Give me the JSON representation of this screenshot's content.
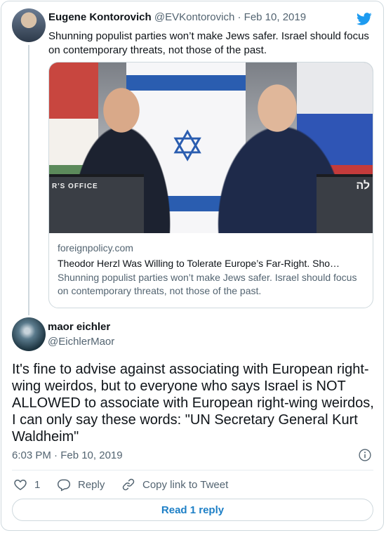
{
  "parent": {
    "name": "Eugene Kontorovich",
    "handle": "@EVKontorovich",
    "separator": "·",
    "date": "Feb 10, 2019",
    "text": "Shunning populist parties won’t make Jews safer. Israel should focus on contemporary threats, not those of the past.",
    "link_card": {
      "domain": "foreignpolicy.com",
      "headline": "Theodor Herzl Was Willing to Tolerate Europe’s Far-Right. Sho…",
      "description": "Shunning populist parties won’t make Jews safer. Israel should focus on contemporary threats, not those of the past.",
      "podium_left_text": "R'S OFFICE",
      "podium_right_text": "לה"
    }
  },
  "tweet": {
    "name": "maor eichler",
    "handle": "@EichlerMaor",
    "text": "It's fine to advise against associating with European right-wing weirdos, but to everyone who says Israel is NOT ALLOWED to associate with European right-wing weirdos, I can only say these words: \"UN Secretary General Kurt Waldheim\"",
    "time": "6:03 PM · Feb 10, 2019"
  },
  "actions": {
    "like_count": "1",
    "reply_label": "Reply",
    "copy_label": "Copy link to Tweet"
  },
  "read_button": "Read 1 reply",
  "icons": {
    "brand": "twitter-bird-icon",
    "info": "info-icon",
    "like": "heart-icon",
    "reply": "reply-bubble-icon",
    "copy": "link-icon"
  },
  "colors": {
    "brand_blue": "#1d9bf0",
    "link_blue": "#1d7fc6",
    "secondary_text": "#536471",
    "border": "#cfd9de"
  }
}
